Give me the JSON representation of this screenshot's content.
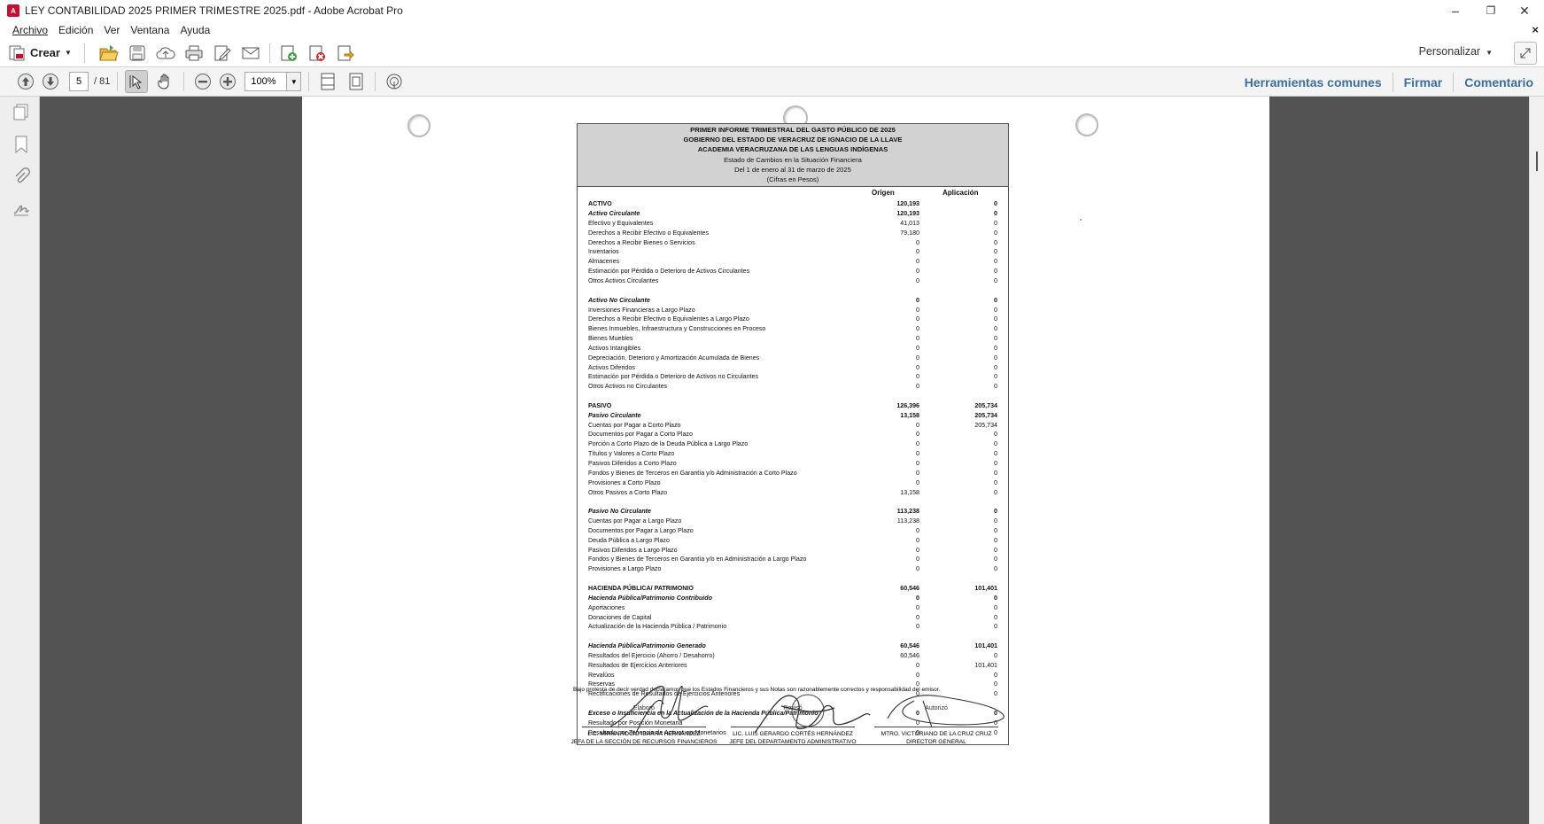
{
  "window": {
    "title": "LEY CONTABILIDAD 2025 PRIMER TRIMESTRE 2025.pdf - Adobe Acrobat Pro",
    "minimize": "–",
    "restore": "❐",
    "close": "✕"
  },
  "menu": {
    "items": [
      "Archivo",
      "Edición",
      "Ver",
      "Ventana",
      "Ayuda"
    ],
    "close_doc": "×"
  },
  "toolbar": {
    "create_label": "Crear",
    "customize_label": "Personalizar"
  },
  "nav": {
    "page_current": "5",
    "page_total": "/ 81",
    "zoom": "100%"
  },
  "links": {
    "tools": "Herramientas comunes",
    "sign": "Firmar",
    "comment": "Comentario"
  },
  "colors": {
    "link": "#3a6ea5",
    "viewer_bg": "#535353",
    "header_fill": "#d2d2d2"
  },
  "report": {
    "title_lines": [
      "PRIMER INFORME TRIMESTRAL DEL GASTO PÚBLICO DE 2025",
      "GOBIERNO DEL ESTADO DE VERACRUZ DE IGNACIO DE LA LLAVE",
      "ACADEMIA VERACRUZANA DE LAS LENGUAS INDÍGENAS"
    ],
    "sub_lines": [
      "Estado de Cambios en la Situación Financiera",
      "Del 1 de enero al 31 de marzo de 2025",
      "(Cifras en Pesos)"
    ],
    "col_origen": "Origen",
    "col_aplicacion": "Aplicación",
    "rows": [
      {
        "label": "ACTIVO",
        "origen": "120,193",
        "aplicacion": "0",
        "style": "b"
      },
      {
        "label": "Activo Circulante",
        "origen": "120,193",
        "aplicacion": "0",
        "style": "bi"
      },
      {
        "label": "Efectivo y Equivalentes",
        "origen": "41,013",
        "aplicacion": "0"
      },
      {
        "label": "Derechos a Recibir Efectivo o Equivalentes",
        "origen": "79,180",
        "aplicacion": "0"
      },
      {
        "label": "Derechos a Recibir Bienes o Servicios",
        "origen": "0",
        "aplicacion": "0"
      },
      {
        "label": "Inventarios",
        "origen": "0",
        "aplicacion": "0"
      },
      {
        "label": "Almacenes",
        "origen": "0",
        "aplicacion": "0"
      },
      {
        "label": "Estimación por Pérdida o Deterioro de Activos Circulantes",
        "origen": "0",
        "aplicacion": "0"
      },
      {
        "label": "Otros Activos  Circulantes",
        "origen": "0",
        "aplicacion": "0"
      },
      {
        "label": "",
        "origen": "",
        "aplicacion": ""
      },
      {
        "label": "Activo No Circulante",
        "origen": "0",
        "aplicacion": "0",
        "style": "bi"
      },
      {
        "label": "Inversiones Financieras a Largo Plazo",
        "origen": "0",
        "aplicacion": "0"
      },
      {
        "label": "Derechos a Recibir Efectivo o Equivalentes a Largo Plazo",
        "origen": "0",
        "aplicacion": "0"
      },
      {
        "label": "Bienes Inmuebles, Infraestructura y Construcciones en Proceso",
        "origen": "0",
        "aplicacion": "0"
      },
      {
        "label": "Bienes Muebles",
        "origen": "0",
        "aplicacion": "0"
      },
      {
        "label": "Activos Intangibles",
        "origen": "0",
        "aplicacion": "0"
      },
      {
        "label": "Depreciación, Deterioro y Amortización Acumulada de Bienes",
        "origen": "0",
        "aplicacion": "0"
      },
      {
        "label": "Activos Diferidos",
        "origen": "0",
        "aplicacion": "0"
      },
      {
        "label": "Estimación por Pérdida o Deterioro de Activos no Circulantes",
        "origen": "0",
        "aplicacion": "0"
      },
      {
        "label": "Otros Activos no Circulantes",
        "origen": "0",
        "aplicacion": "0"
      },
      {
        "label": "",
        "origen": "",
        "aplicacion": ""
      },
      {
        "label": "PASIVO",
        "origen": "126,396",
        "aplicacion": "205,734",
        "style": "b"
      },
      {
        "label": "Pasivo Circulante",
        "origen": "13,158",
        "aplicacion": "205,734",
        "style": "bi"
      },
      {
        "label": "Cuentas por Pagar a Corto Plazo",
        "origen": "0",
        "aplicacion": "205,734"
      },
      {
        "label": "Documentos por Pagar a Corto Plazo",
        "origen": "0",
        "aplicacion": "0"
      },
      {
        "label": "Porción a Corto Plazo de la Deuda Pública a Largo Plazo",
        "origen": "0",
        "aplicacion": "0"
      },
      {
        "label": "Títulos y Valores a Corto Plazo",
        "origen": "0",
        "aplicacion": "0"
      },
      {
        "label": "Pasivos Diferidos a Corto Plazo",
        "origen": "0",
        "aplicacion": "0"
      },
      {
        "label": "Fondos y Bienes de Terceros en Garantía y/o Administración a Corto Plazo",
        "origen": "0",
        "aplicacion": "0"
      },
      {
        "label": "Provisiones a Corto Plazo",
        "origen": "0",
        "aplicacion": "0"
      },
      {
        "label": "Otros Pasivos a Corto Plazo",
        "origen": "13,158",
        "aplicacion": "0"
      },
      {
        "label": "",
        "origen": "",
        "aplicacion": ""
      },
      {
        "label": "Pasivo No Circulante",
        "origen": "113,238",
        "aplicacion": "0",
        "style": "bi"
      },
      {
        "label": "Cuentas por Pagar a Largo Plazo",
        "origen": "113,238",
        "aplicacion": "0"
      },
      {
        "label": "Documentos por Pagar a Largo Plazo",
        "origen": "0",
        "aplicacion": "0"
      },
      {
        "label": "Deuda Pública a Largo Plazo",
        "origen": "0",
        "aplicacion": "0"
      },
      {
        "label": "Pasivos Diferidos a Largo Plazo",
        "origen": "0",
        "aplicacion": "0"
      },
      {
        "label": "Fondos y Bienes de Terceros en Garantía y/o en Administración a Largo Plazo",
        "origen": "0",
        "aplicacion": "0"
      },
      {
        "label": "Provisiones a Largo Plazo",
        "origen": "0",
        "aplicacion": "0"
      },
      {
        "label": "",
        "origen": "",
        "aplicacion": ""
      },
      {
        "label": "HACIENDA PÚBLICA/ PATRIMONIO",
        "origen": "60,546",
        "aplicacion": "101,401",
        "style": "b"
      },
      {
        "label": "Hacienda Pública/Patrimonio Contribuido",
        "origen": "0",
        "aplicacion": "0",
        "style": "bi"
      },
      {
        "label": "Aportaciones",
        "origen": "0",
        "aplicacion": "0"
      },
      {
        "label": "Donaciones de Capital",
        "origen": "0",
        "aplicacion": "0"
      },
      {
        "label": "Actualización de la Hacienda Pública / Patrimonio",
        "origen": "0",
        "aplicacion": "0"
      },
      {
        "label": "",
        "origen": "",
        "aplicacion": ""
      },
      {
        "label": "Hacienda Pública/Patrimonio Generado",
        "origen": "60,546",
        "aplicacion": "101,401",
        "style": "bi"
      },
      {
        "label": "Resultados del Ejercicio (Ahorro / Desahorro)",
        "origen": "60,546",
        "aplicacion": "0"
      },
      {
        "label": "Resultados de Ejercicios Anteriores",
        "origen": "0",
        "aplicacion": "101,401"
      },
      {
        "label": "Revalúos",
        "origen": "0",
        "aplicacion": "0"
      },
      {
        "label": "Reservas",
        "origen": "0",
        "aplicacion": "0"
      },
      {
        "label": "Rectificaciones de Resultados de Ejercicios Anteriores",
        "origen": "0",
        "aplicacion": "0"
      },
      {
        "label": "",
        "origen": "",
        "aplicacion": ""
      },
      {
        "label": "Exceso o Insuficiencia en la Actualización de la Hacienda Pública/Patrimonio",
        "origen": "0",
        "aplicacion": "0",
        "style": "bi"
      },
      {
        "label": "Resultado por Posición Monetaria",
        "origen": "0",
        "aplicacion": "0"
      },
      {
        "label": "Resultado por Tenencia de Activos no Monetarios",
        "origen": "0",
        "aplicacion": "0"
      }
    ],
    "footnote": "Bajo protesta de decir verdad declaramos que los Estados Financieros y sus Notas son razonablemente correctos y responsabilidad del emisor.",
    "signers": [
      {
        "role": "Elaboró",
        "name": "L.C. MIRNA ROCÍO IBARRA HERNÁNDEZ",
        "title": "JEFA DE LA SECCIÓN DE RECURSOS FINANCIEROS"
      },
      {
        "role": "Revisó",
        "name": "LIC. LUIS GERARDO CORTÉS HERNÁNDEZ",
        "title": "JEFE DEL DEPARTAMENTO ADMINISTRATIVO"
      },
      {
        "role": "Autorizó",
        "name": "MTRO. VICTORIANO DE LA CRUZ CRUZ",
        "title": "DIRECTOR GENERAL"
      }
    ]
  }
}
